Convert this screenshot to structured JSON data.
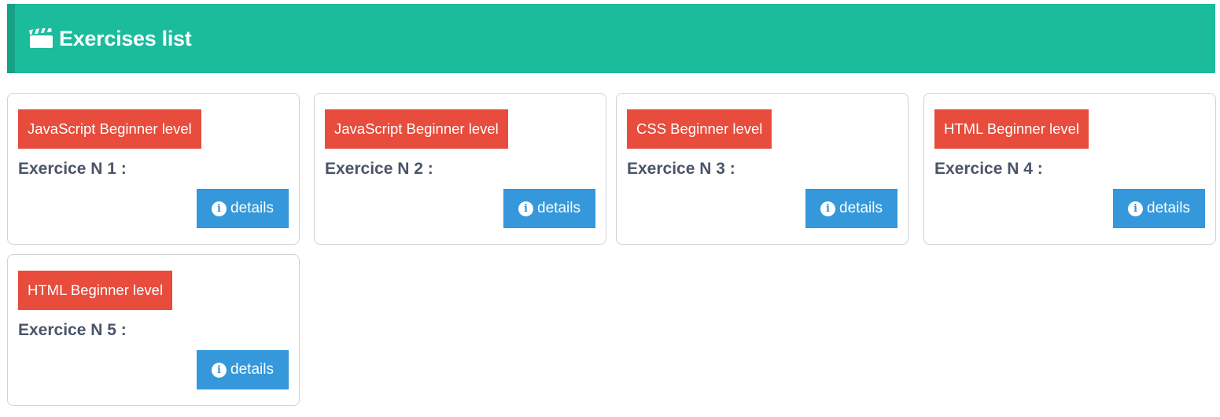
{
  "header": {
    "icon": "clapperboard-icon",
    "title": "Exercises list",
    "background_color": "#1abc9c",
    "accent_color": "#16a085"
  },
  "colors": {
    "badge": "#e74c3c",
    "details_button": "#3498db",
    "title_text": "#4a5568"
  },
  "cards": [
    {
      "badge": "JavaScript Beginner level",
      "title": "Exercice N 1 :",
      "button_label": "details",
      "button_icon": "info-circle-icon"
    },
    {
      "badge": "JavaScript Beginner level",
      "title": "Exercice N 2 :",
      "button_label": "details",
      "button_icon": "info-circle-icon"
    },
    {
      "badge": "CSS Beginner level",
      "title": "Exercice N 3 :",
      "button_label": "details",
      "button_icon": "info-circle-icon"
    },
    {
      "badge": "HTML Beginner level",
      "title": "Exercice N 4 :",
      "button_label": "details",
      "button_icon": "info-circle-icon"
    },
    {
      "badge": "HTML Beginner level",
      "title": "Exercice N 5 :",
      "button_label": "details",
      "button_icon": "info-circle-icon"
    }
  ]
}
